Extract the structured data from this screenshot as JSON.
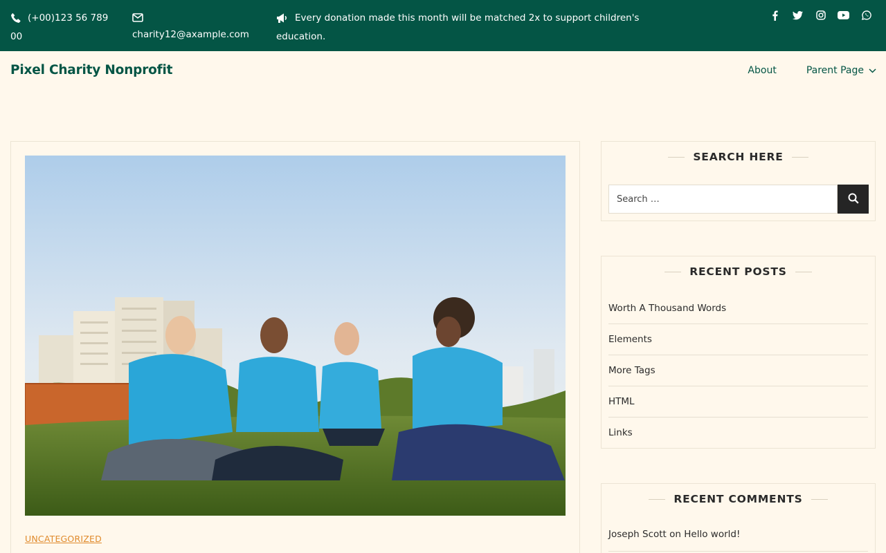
{
  "topbar": {
    "phone": "(+00)123 56 789 00",
    "email": "charity12@axample.com",
    "notice": "Every donation made this month will be matched 2x to support children's education.",
    "socials": [
      "facebook-icon",
      "twitter-icon",
      "instagram-icon",
      "youtube-icon",
      "whatsapp-icon"
    ]
  },
  "header": {
    "site_title": "Pixel Charity Nonprofit",
    "nav": [
      {
        "label": "About"
      },
      {
        "label": "Parent Page"
      }
    ]
  },
  "post": {
    "category": "UNCATEGORIZED",
    "image_subject": "volunteers-photo"
  },
  "sidebar": {
    "search": {
      "title": "SEARCH HERE",
      "placeholder": "Search …"
    },
    "recent_posts": {
      "title": "RECENT POSTS",
      "items": [
        "Worth A Thousand Words",
        "Elements",
        "More Tags",
        "HTML",
        "Links"
      ]
    },
    "recent_comments": {
      "title": "RECENT COMMENTS",
      "author": "Joseph Scott",
      "connector": "on",
      "post": "Hello world!"
    }
  },
  "colors": {
    "topbar_bg": "#045545",
    "page_bg": "#fff8ec",
    "accent_orange": "#e08a2c",
    "search_button": "#252525"
  }
}
